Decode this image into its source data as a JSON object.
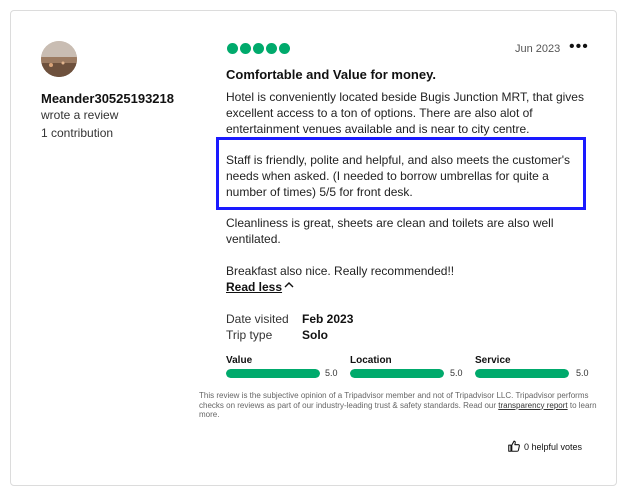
{
  "reviewer": {
    "username": "Meander30525193218",
    "action": "wrote a review",
    "contributions": "1 contribution"
  },
  "review": {
    "rating_bubbles": 5,
    "date": "Jun 2023",
    "title": "Comfortable and Value for money.",
    "paragraphs": [
      "Hotel is conveniently located beside Bugis Junction MRT, that gives excellent access to a ton of options. There are also alot of entertainment venues available and is near to city centre.",
      "Staff is friendly, polite and helpful, and also meets the customer's needs when asked. (I needed to borrow umbrellas for quite a number of times) 5/5 for front desk.",
      "Cleanliness is great, sheets are clean and toilets are also well ventilated.",
      "Breakfast also nice. Really recommended!!"
    ],
    "read_less": "Read less",
    "date_visited_label": "Date visited",
    "date_visited": "Feb 2023",
    "trip_type_label": "Trip type",
    "trip_type": "Solo",
    "sub_ratings": [
      {
        "label": "Value",
        "score": "5.0",
        "fraction": 1.0
      },
      {
        "label": "Location",
        "score": "5.0",
        "fraction": 1.0
      },
      {
        "label": "Service",
        "score": "5.0",
        "fraction": 1.0
      }
    ],
    "disclaimer_prefix": "This review is the subjective opinion of a Tripadvisor member and not of Tripadvisor LLC. Tripadvisor performs checks on reviews as part of our industry-leading trust & safety standards. Read our ",
    "disclaimer_link": "transparency report",
    "disclaimer_suffix": " to learn more.",
    "helpful_votes": "0 helpful votes"
  },
  "colors": {
    "accent_green": "#00aa6c",
    "highlight_border": "#1a1aff"
  },
  "icons": {
    "more": "more-options-icon",
    "chevron": "chevron-up-icon",
    "thumbs": "thumbs-up-icon"
  }
}
